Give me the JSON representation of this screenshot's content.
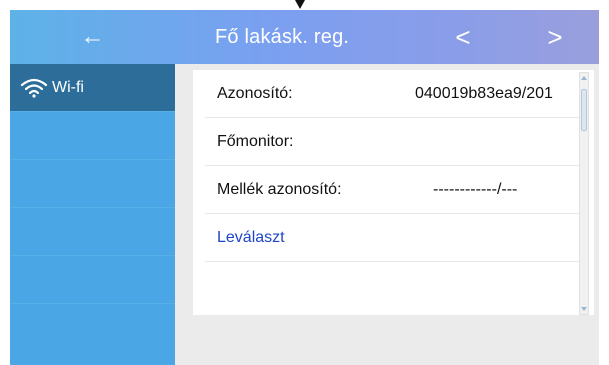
{
  "header": {
    "back_icon": "←",
    "title": "Fő lakásk. reg.",
    "prev_icon": "<",
    "next_icon": ">"
  },
  "sidebar": {
    "items": [
      {
        "label": "Wi-fi",
        "icon": "wifi-icon",
        "active": true
      },
      {
        "label": ""
      },
      {
        "label": ""
      },
      {
        "label": ""
      },
      {
        "label": ""
      }
    ]
  },
  "panel": {
    "rows": [
      {
        "label": "Azonosító:",
        "value": "040019b83ea9/201"
      },
      {
        "label": "Főmonitor:",
        "value": ""
      },
      {
        "label": "Mellék azonosító:",
        "value": "------------/---"
      },
      {
        "link": "Leválaszt"
      }
    ]
  },
  "colors": {
    "header_gradient_start": "#5db2e8",
    "header_gradient_end": "#9a9fdc",
    "sidebar": "#4aa6e4",
    "sidebar_active": "#2c6d99",
    "link": "#1e45c9",
    "content_bg": "#ebebeb"
  }
}
